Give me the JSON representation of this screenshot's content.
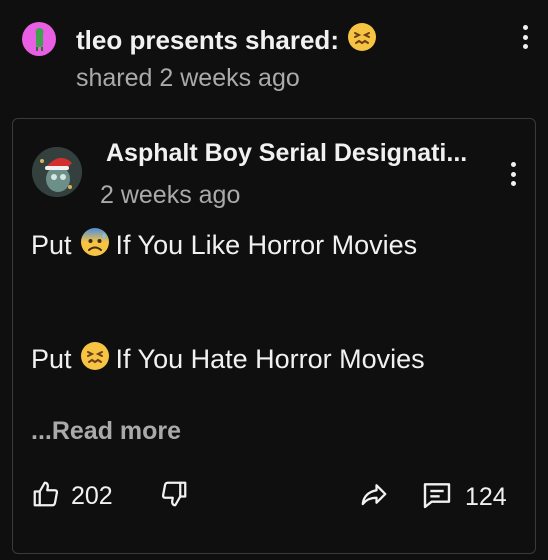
{
  "shared_header": {
    "title": "tleo presents shared:",
    "time": "shared 2 weeks ago"
  },
  "post": {
    "author": "Asphalt Boy Serial Designati...",
    "time": "2 weeks ago",
    "line1": {
      "prefix": "Put",
      "suffix": "If You Like Horror Movies"
    },
    "line2": {
      "prefix": "Put",
      "suffix": "If You Hate Horror Movies"
    },
    "read_more": "...Read more"
  },
  "actions": {
    "like_count": "202",
    "comment_count": "124"
  },
  "colors": {
    "background": "#0f0f0f",
    "card_border": "#3a3a3a",
    "secondary_text": "#aaaaaa",
    "sharer_avatar": "#e95fe4"
  },
  "icons": [
    "confounded-emoji",
    "anxious-sweat-emoji",
    "more-vert-icon",
    "thumb-up-icon",
    "thumb-down-icon",
    "share-icon",
    "comment-icon"
  ]
}
